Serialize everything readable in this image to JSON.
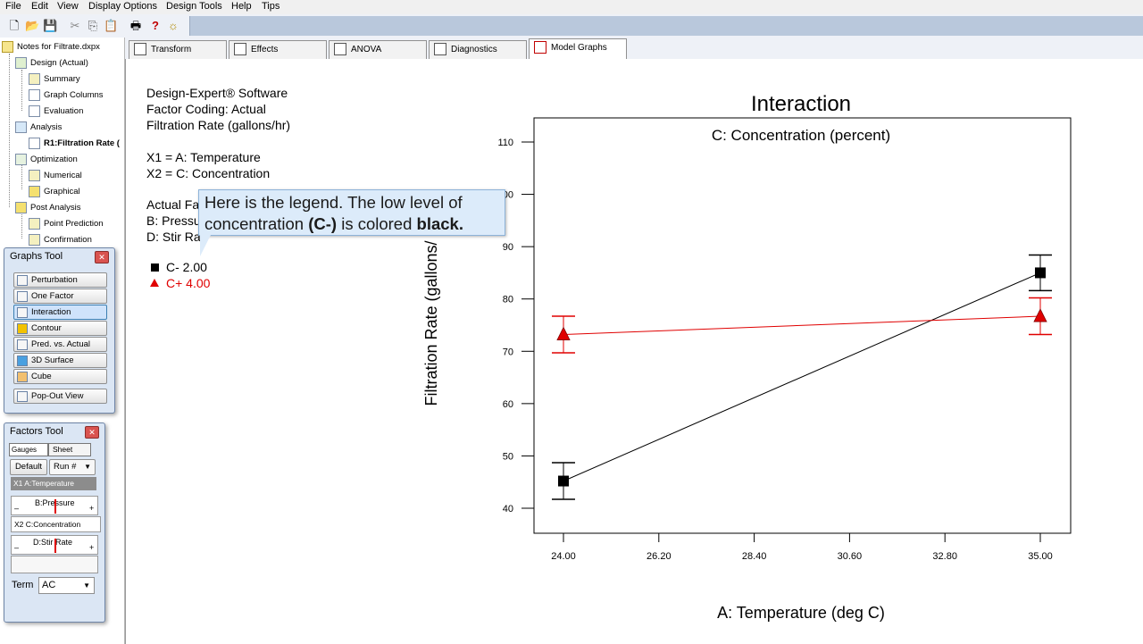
{
  "menu": [
    "File",
    "Edit",
    "View",
    "Display Options",
    "Design Tools",
    "Help",
    "Tips"
  ],
  "toolbar_icons": [
    "new-file-icon",
    "open-folder-icon",
    "save-icon",
    "cut-icon",
    "copy-icon",
    "paste-icon",
    "print-icon",
    "help-icon",
    "tip-bulb-icon"
  ],
  "tree": {
    "root": "Notes for Filtrate.dxpx",
    "design": "Design (Actual)",
    "summary": "Summary",
    "graph_columns": "Graph Columns",
    "evaluation": "Evaluation",
    "analysis": "Analysis",
    "r1": "R1:Filtration Rate (",
    "optimization": "Optimization",
    "numerical": "Numerical",
    "graphical": "Graphical",
    "post_analysis": "Post Analysis",
    "point_prediction": "Point Prediction",
    "confirmation": "Confirmation"
  },
  "graphs_tool": {
    "title": "Graphs Tool",
    "buttons": [
      "Perturbation",
      "One Factor",
      "Interaction",
      "Contour",
      "Pred. vs. Actual",
      "3D Surface",
      "Cube"
    ],
    "popout": "Pop-Out View",
    "selected": "Interaction"
  },
  "factors_tool": {
    "title": "Factors Tool",
    "tab_gauges": "Gauges",
    "tab_sheet": "Sheet",
    "default_btn": "Default",
    "run_select": "Run #",
    "x1": "X1 A:Temperature",
    "b_label": "B:Pressure",
    "x2": "X2 C:Concentration",
    "d_label": "D:Stir Rate",
    "minus": "–",
    "plus": "+",
    "term_label": "Term",
    "term_value": "AC"
  },
  "tabs": [
    "Transform",
    "Effects",
    "ANOVA",
    "Diagnostics",
    "Model Graphs"
  ],
  "active_tab": "Model Graphs",
  "info": {
    "l1": "Design-Expert® Software",
    "l2": "Factor Coding: Actual",
    "l3": "Filtration Rate (gallons/hr)",
    "l4": "X1 = A: Temperature",
    "l5": "X2 = C: Concentration",
    "l6": "Actual Fa",
    "l7": "B: Pressu",
    "l8": "D: Stir Ra"
  },
  "callout": {
    "part1": "Here is the legend.  The low level of concentration ",
    "bold1": "(C-)",
    "part2": " is colored ",
    "bold2": "black."
  },
  "legend": [
    {
      "label": "C- 2.00",
      "color": "#000000",
      "marker": "square"
    },
    {
      "label": "C+ 4.00",
      "color": "#e00000",
      "marker": "triangle"
    }
  ],
  "chart_data": {
    "type": "line",
    "title": "Interaction",
    "subtitle": "C: Concentration (percent)",
    "xlabel": "A: Temperature (deg C)",
    "ylabel": "Filtration Rate (gallons/",
    "xlim": [
      24.0,
      35.0
    ],
    "ylim": [
      35,
      115
    ],
    "xticks": [
      "24.00",
      "26.20",
      "28.40",
      "30.60",
      "32.80",
      "35.00"
    ],
    "xtick_values": [
      24.0,
      26.2,
      28.4,
      30.6,
      32.8,
      35.0
    ],
    "yticks": [
      40,
      50,
      60,
      70,
      80,
      90,
      100,
      110
    ],
    "series": [
      {
        "name": "C- 2.00",
        "color": "#000000",
        "marker": "square",
        "x": [
          24.0,
          35.0
        ],
        "y": [
          45.2,
          85.0
        ],
        "err_low": [
          41.7,
          81.6
        ],
        "err_high": [
          48.7,
          88.4
        ]
      },
      {
        "name": "C+ 4.00",
        "color": "#e00000",
        "marker": "triangle",
        "x": [
          24.0,
          35.0
        ],
        "y": [
          73.2,
          76.7
        ],
        "err_low": [
          69.7,
          73.2
        ],
        "err_high": [
          76.7,
          80.2
        ]
      }
    ]
  }
}
